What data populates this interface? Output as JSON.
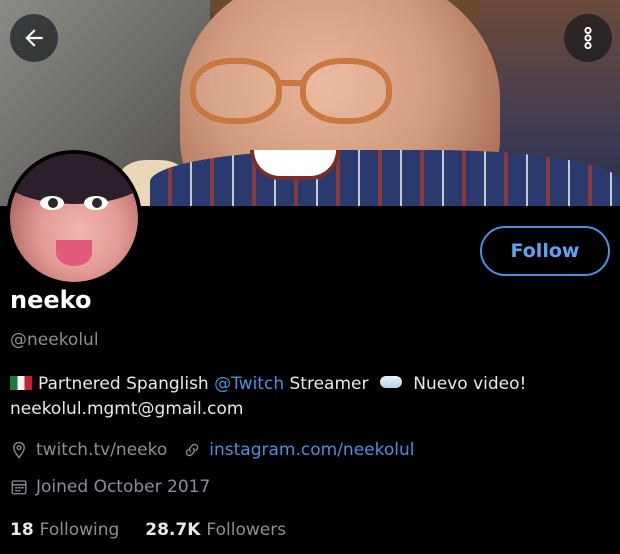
{
  "header": {
    "back_icon": "arrow-left-icon",
    "more_icon": "vertical-dots-icon"
  },
  "profile": {
    "name": "neeko",
    "handle": "@neekolul",
    "follow_label": "Follow",
    "bio": {
      "flag_icon": "mexico-flag-icon",
      "part1": "Partnered Spanglish ",
      "mention": "@Twitch",
      "part2": " Streamer ",
      "cloud_icon": "cloud-icon",
      "part3": " Nuevo video!",
      "line2": "neekolul.mgmt@gmail.com"
    },
    "website": "twitch.tv/neeko",
    "instagram": "instagram.com/neekolul",
    "joined": "Joined October 2017",
    "following_count": "18",
    "following_label": "Following",
    "followers_count": "28.7K",
    "followers_label": "Followers"
  },
  "colors": {
    "accent": "#4a90e2",
    "background": "#000000",
    "muted_text": "#8a9099"
  }
}
